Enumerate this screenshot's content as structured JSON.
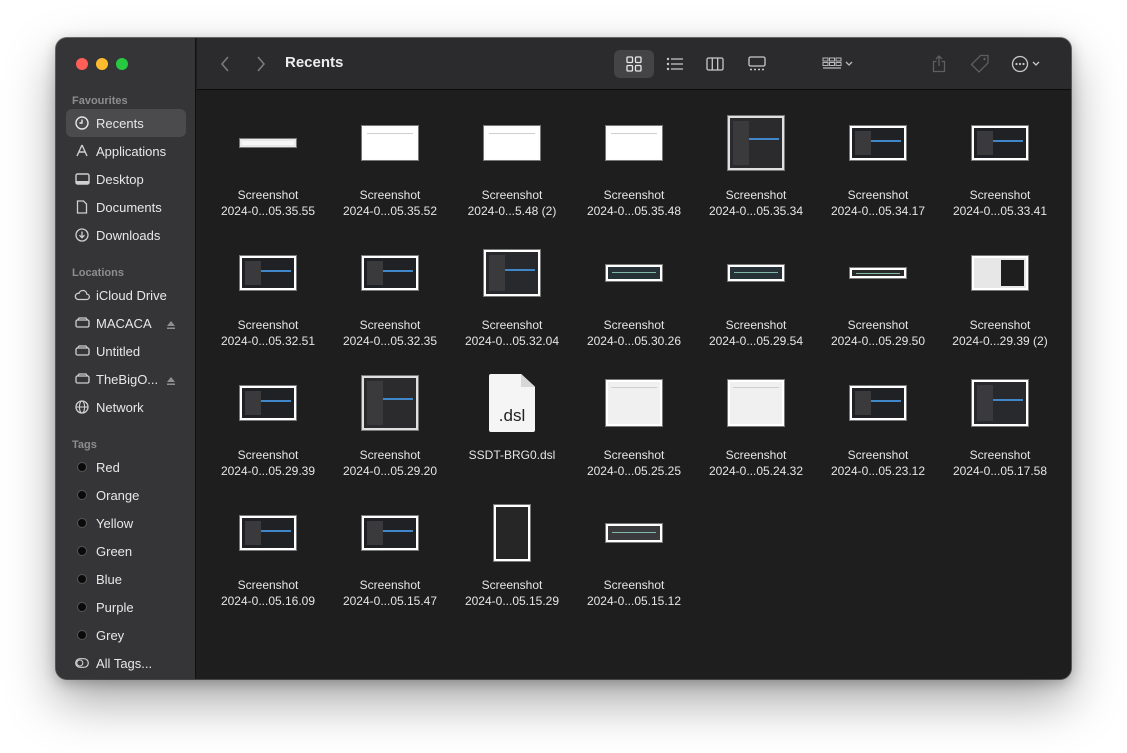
{
  "window": {
    "title": "Recents"
  },
  "sidebar": {
    "favourites_label": "Favourites",
    "favourites": [
      {
        "label": "Recents",
        "icon": "clock-icon",
        "selected": true
      },
      {
        "label": "Applications",
        "icon": "applications-icon"
      },
      {
        "label": "Desktop",
        "icon": "desktop-icon"
      },
      {
        "label": "Documents",
        "icon": "document-icon"
      },
      {
        "label": "Downloads",
        "icon": "download-icon"
      }
    ],
    "locations_label": "Locations",
    "locations": [
      {
        "label": "iCloud Drive",
        "icon": "cloud-icon"
      },
      {
        "label": "MACACA",
        "icon": "disk-icon",
        "eject": true
      },
      {
        "label": "Untitled",
        "icon": "disk-icon"
      },
      {
        "label": "TheBigO...",
        "icon": "disk-icon",
        "eject": true
      },
      {
        "label": "Network",
        "icon": "globe-icon"
      }
    ],
    "tags_label": "Tags",
    "tags": [
      {
        "label": "Red"
      },
      {
        "label": "Orange"
      },
      {
        "label": "Yellow"
      },
      {
        "label": "Green"
      },
      {
        "label": "Blue"
      },
      {
        "label": "Purple"
      },
      {
        "label": "Grey"
      },
      {
        "label": "All Tags..."
      }
    ]
  },
  "files": [
    {
      "line1": "Screenshot",
      "line2": "2024-0...05.35.55",
      "kind": "thin"
    },
    {
      "line1": "Screenshot",
      "line2": "2024-0...05.35.52",
      "kind": "white"
    },
    {
      "line1": "Screenshot",
      "line2": "2024-0...5.48 (2)",
      "kind": "white"
    },
    {
      "line1": "Screenshot",
      "line2": "2024-0...05.35.48",
      "kind": "white"
    },
    {
      "line1": "Screenshot",
      "line2": "2024-0...05.35.34",
      "kind": "square"
    },
    {
      "line1": "Screenshot",
      "line2": "2024-0...05.34.17",
      "kind": "dark"
    },
    {
      "line1": "Screenshot",
      "line2": "2024-0...05.33.41",
      "kind": "dark"
    },
    {
      "line1": "Screenshot",
      "line2": "2024-0...05.32.51",
      "kind": "dark"
    },
    {
      "line1": "Screenshot",
      "line2": "2024-0...05.32.35",
      "kind": "dark"
    },
    {
      "line1": "Screenshot",
      "line2": "2024-0...05.32.04",
      "kind": "darksq"
    },
    {
      "line1": "Screenshot",
      "line2": "2024-0...05.30.26",
      "kind": "strip"
    },
    {
      "line1": "Screenshot",
      "line2": "2024-0...05.29.54",
      "kind": "strip"
    },
    {
      "line1": "Screenshot",
      "line2": "2024-0...05.29.50",
      "kind": "thinstrip"
    },
    {
      "line1": "Screenshot",
      "line2": "2024-0...29.39 (2)",
      "kind": "mixed"
    },
    {
      "line1": "Screenshot",
      "line2": "2024-0...05.29.39",
      "kind": "dark"
    },
    {
      "line1": "Screenshot",
      "line2": "2024-0...05.29.20",
      "kind": "square"
    },
    {
      "line1": "SSDT-BRG0.dsl",
      "line2": "",
      "kind": "doc",
      "ext": ".dsl"
    },
    {
      "line1": "Screenshot",
      "line2": "2024-0...05.25.25",
      "kind": "light"
    },
    {
      "line1": "Screenshot",
      "line2": "2024-0...05.24.32",
      "kind": "light"
    },
    {
      "line1": "Screenshot",
      "line2": "2024-0...05.23.12",
      "kind": "dark"
    },
    {
      "line1": "Screenshot",
      "line2": "2024-0...05.17.58",
      "kind": "darksq"
    },
    {
      "line1": "Screenshot",
      "line2": "2024-0...05.16.09",
      "kind": "dark"
    },
    {
      "line1": "Screenshot",
      "line2": "2024-0...05.15.47",
      "kind": "dark"
    },
    {
      "line1": "Screenshot",
      "line2": "2024-0...05.15.29",
      "kind": "tall"
    },
    {
      "line1": "Screenshot",
      "line2": "2024-0...05.15.12",
      "kind": "strip2"
    }
  ]
}
